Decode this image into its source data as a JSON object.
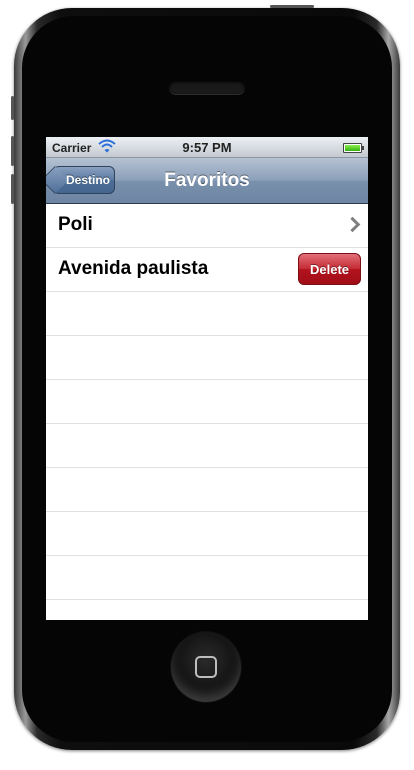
{
  "status_bar": {
    "carrier": "Carrier",
    "time": "9:57 PM",
    "wifi_icon": "wifi-icon",
    "battery_icon": "battery-icon",
    "battery_level": 1.0
  },
  "navigation": {
    "back_button_label": "Destino",
    "title": "Favoritos"
  },
  "favorites": [
    {
      "label": "Poli",
      "accessory": "chevron-right-icon"
    },
    {
      "label": "Avenida paulista",
      "accessory": "delete-button",
      "delete_label": "Delete"
    }
  ],
  "empty_row_count": 7,
  "colors": {
    "navbar": "#6d85a3",
    "delete": "#b3141e",
    "battery": "#34b014"
  }
}
